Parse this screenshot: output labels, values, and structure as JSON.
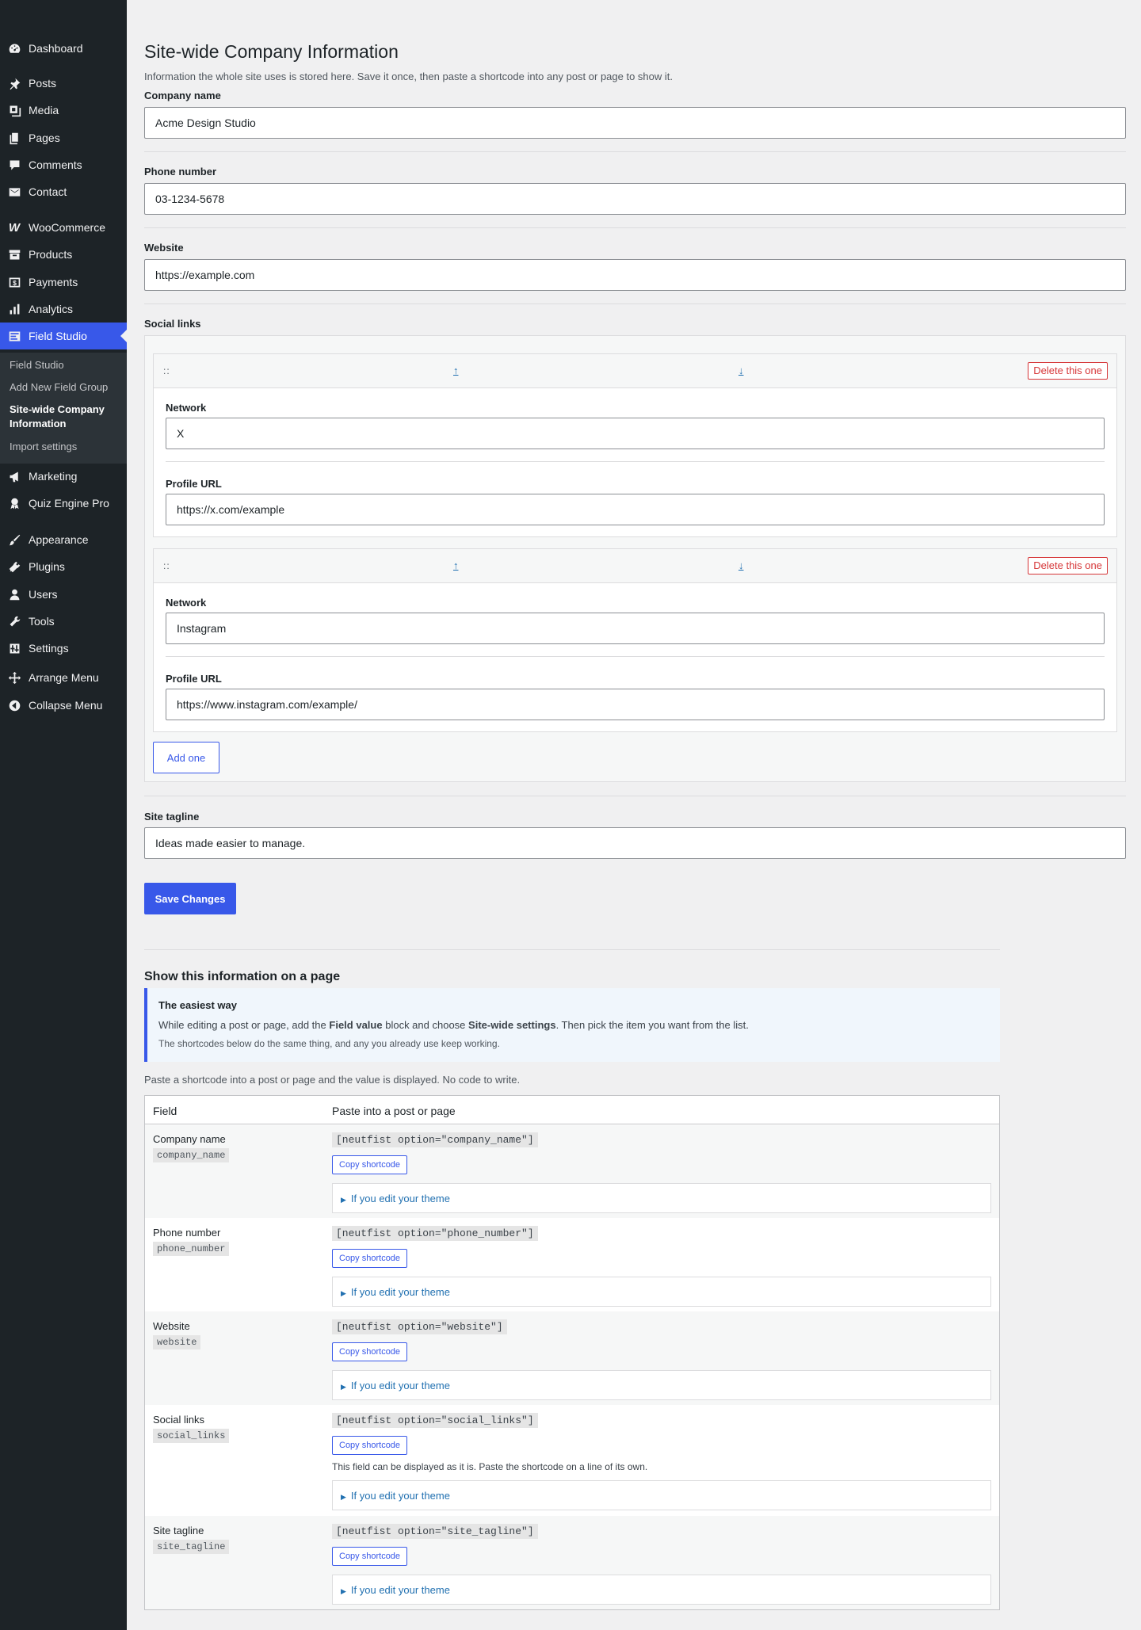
{
  "sidebar": {
    "items": [
      {
        "label": "Dashboard",
        "icon": "dashboard-icon"
      },
      {
        "label": "Posts",
        "icon": "pin-icon"
      },
      {
        "label": "Media",
        "icon": "media-icon"
      },
      {
        "label": "Pages",
        "icon": "pages-icon"
      },
      {
        "label": "Comments",
        "icon": "comments-icon"
      },
      {
        "label": "Contact",
        "icon": "mail-icon"
      },
      {
        "label": "WooCommerce",
        "icon": "woocommerce-icon"
      },
      {
        "label": "Products",
        "icon": "archive-icon"
      },
      {
        "label": "Payments",
        "icon": "dollar-icon"
      },
      {
        "label": "Analytics",
        "icon": "bar-chart-icon"
      },
      {
        "label": "Field Studio",
        "icon": "form-icon"
      },
      {
        "label": "Marketing",
        "icon": "megaphone-icon"
      },
      {
        "label": "Quiz Engine Pro",
        "icon": "award-icon"
      },
      {
        "label": "Appearance",
        "icon": "brush-icon"
      },
      {
        "label": "Plugins",
        "icon": "plug-icon"
      },
      {
        "label": "Users",
        "icon": "user-icon"
      },
      {
        "label": "Tools",
        "icon": "wrench-icon"
      },
      {
        "label": "Settings",
        "icon": "settings-icon"
      },
      {
        "label": "Arrange Menu",
        "icon": "move-icon"
      },
      {
        "label": "Collapse Menu",
        "icon": "collapse-icon"
      }
    ],
    "submenu": [
      "Field Studio",
      "Add New Field Group",
      "Site-wide Company Information",
      "Import settings"
    ],
    "accent": "#3858e9"
  },
  "page": {
    "title": "Site-wide Company Information",
    "description": "Information the whole site uses is stored here. Save it once, then paste a shortcode into any post or page to show it."
  },
  "form": {
    "company_name": {
      "label": "Company name",
      "value": "Acme Design Studio"
    },
    "phone_number": {
      "label": "Phone number",
      "value": "03-1234-5678"
    },
    "website": {
      "label": "Website",
      "value": "https://example.com"
    },
    "social_links": {
      "label": "Social links",
      "handle": "::",
      "up": "↑",
      "down": "↓",
      "delete_label": "Delete this one",
      "network_label": "Network",
      "profile_label": "Profile URL",
      "rows": [
        {
          "network": "X",
          "profile_url": "https://x.com/example"
        },
        {
          "network": "Instagram",
          "profile_url": "https://www.instagram.com/example/"
        }
      ],
      "add_label": "Add one"
    },
    "site_tagline": {
      "label": "Site tagline",
      "value": "Ideas made easier to manage."
    },
    "save_label": "Save Changes"
  },
  "show": {
    "heading": "Show this information on a page",
    "notice_title": "The easiest way",
    "notice_text_1": "While editing a post or page, add the",
    "notice_bold_1": "Field value",
    "notice_text_2": "block and choose",
    "notice_bold_2": "Site-wide settings",
    "notice_text_3": ". Then pick the item you want from the list.",
    "notice_note": "The shortcodes below do the same thing, and any you already use keep working.",
    "intro": "Paste a shortcode into a post or page and the value is displayed. No code to write.",
    "col_field": "Field",
    "col_paste": "Paste into a post or page",
    "copy_label": "Copy shortcode",
    "details_label": "If you edit your theme",
    "rows": [
      {
        "name": "Company name",
        "key": "company_name",
        "shortcode": "[neutfist option=\"company_name\"]",
        "note": ""
      },
      {
        "name": "Phone number",
        "key": "phone_number",
        "shortcode": "[neutfist option=\"phone_number\"]",
        "note": ""
      },
      {
        "name": "Website",
        "key": "website",
        "shortcode": "[neutfist option=\"website\"]",
        "note": ""
      },
      {
        "name": "Social links",
        "key": "social_links",
        "shortcode": "[neutfist option=\"social_links\"]",
        "note": "This field can be displayed as it is. Paste the shortcode on a line of its own."
      },
      {
        "name": "Site tagline",
        "key": "site_tagline",
        "shortcode": "[neutfist option=\"site_tagline\"]",
        "note": ""
      }
    ]
  }
}
